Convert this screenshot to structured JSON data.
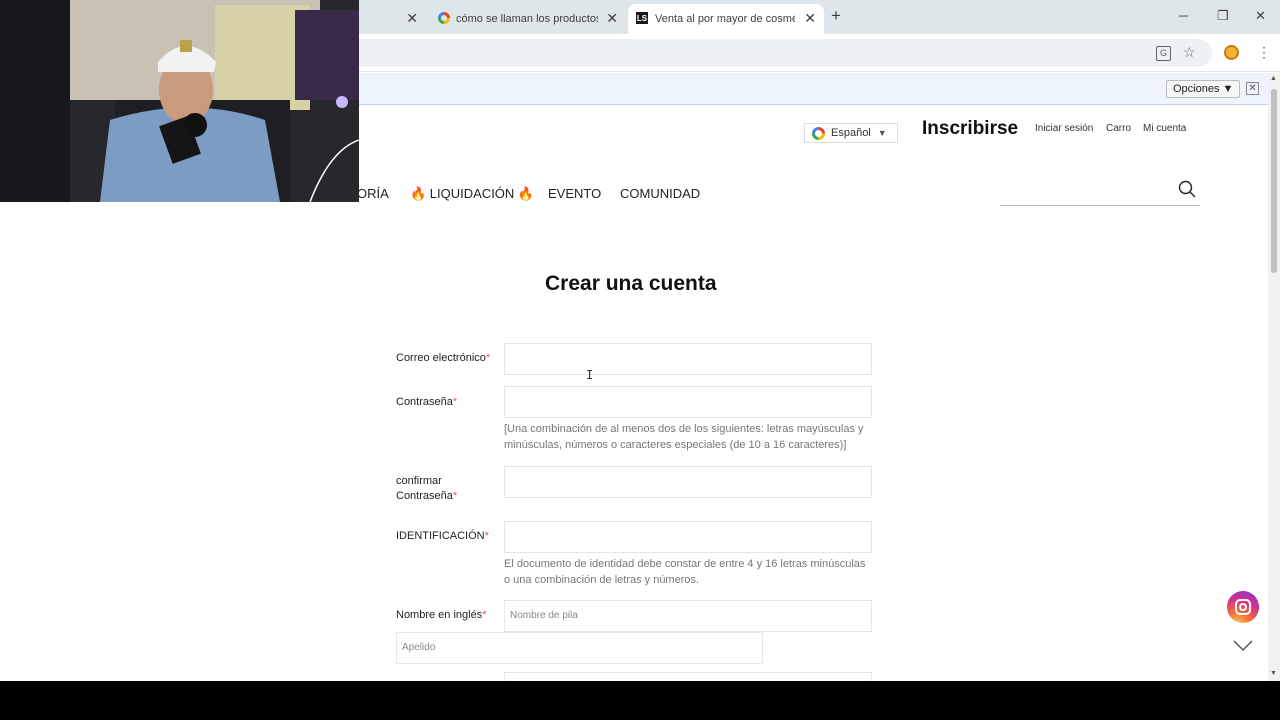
{
  "tabs": [
    {
      "title": "",
      "close": "✕"
    },
    {
      "title": "cómo se llaman los productos d",
      "close": "✕"
    },
    {
      "title": "Venta al por mayor de cosmétic",
      "close": "✕",
      "favicon": "LS"
    }
  ],
  "new_tab": "+",
  "window": {
    "minimize": "─",
    "restore": "❐",
    "close": "✕"
  },
  "translate_bar": {
    "options_label": "Opciones ▼",
    "close": "✕"
  },
  "header": {
    "language": "Español",
    "language_caret": "▼",
    "signup": "Inscribirse",
    "login": "Iniciar sesión",
    "cart": "Carro",
    "account": "Mi cuenta"
  },
  "nav": {
    "item1": "ORÍA",
    "item2": "🔥 LIQUIDACIÓN 🔥",
    "item3": "EVENTO",
    "item4": "COMUNIDAD"
  },
  "form": {
    "title": "Crear una cuenta",
    "email_label": "Correo electrónico",
    "password_label": "Contraseña",
    "password_hint": "[Una combinación de al menos dos de los siguientes: letras mayúsculas y minúsculas, números o caracteres especiales (de 10 a 16 caracteres)]",
    "confirm_label": "confirmar Contraseña",
    "id_label": "IDENTIFICACIÓN",
    "id_hint": "El documento de identidad debe constar de entre 4 y 16 letras minúsculas o una combinación de letras y números.",
    "name_label": "Nombre en inglés",
    "first_name_placeholder": "Nombre de pila",
    "last_name_placeholder": "Apelido",
    "required_mark": "*"
  },
  "icons": {
    "translate": "translate-icon",
    "star": "star-icon",
    "extension": "extension-icon",
    "menu": "kebab-menu-icon",
    "search": "search-icon",
    "instagram": "instagram-icon",
    "chevron": "chevron-down-icon"
  },
  "colors": {
    "tabstrip": "#dfe6e9",
    "translate_bar": "#eef4fb",
    "required": "#e05a5a"
  }
}
